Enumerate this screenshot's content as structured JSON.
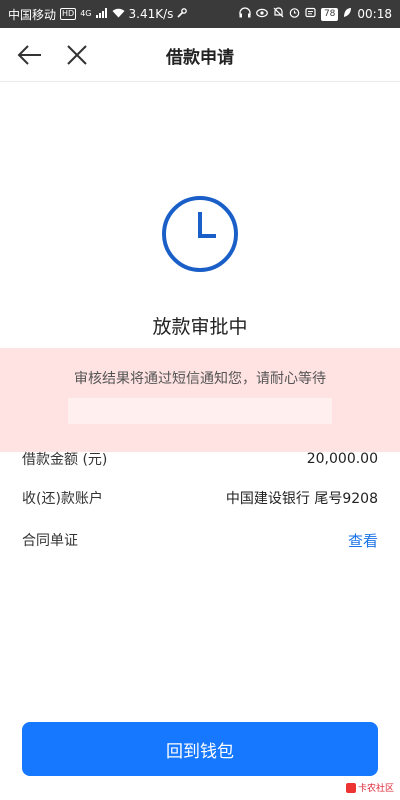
{
  "status_bar": {
    "carrier": "中国移动",
    "hd": "HD",
    "network": "4G",
    "speed": "3.41K/s",
    "battery": "78",
    "time": "00:18"
  },
  "header": {
    "title": "借款申请"
  },
  "status": {
    "title": "放款审批中",
    "notice": "审核结果将通过短信通知您，请耐心等待",
    "icon_color": "#1a5fc8"
  },
  "details": {
    "amount_label": "借款金额 (元)",
    "amount_value": "20,000.00",
    "account_label": "收(还)款账户",
    "account_value": "中国建设银行 尾号9208",
    "contract_label": "合同单证",
    "contract_link": "查看"
  },
  "button": {
    "label": "回到钱包",
    "color": "#1677ff"
  },
  "watermark": {
    "text": "卡农社区"
  }
}
